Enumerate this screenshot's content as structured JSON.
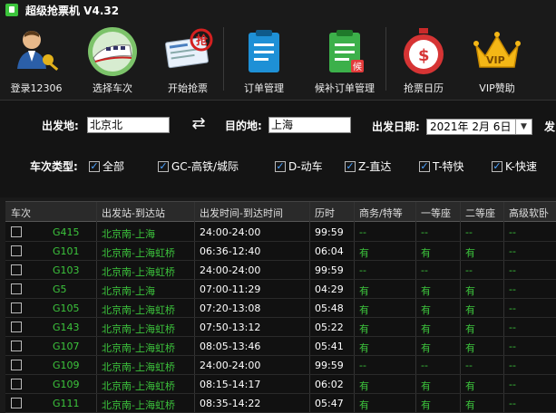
{
  "window": {
    "title": "超级抢票机 V4.32"
  },
  "toolbar": [
    {
      "label": "登录12306",
      "icon": "user-key-icon"
    },
    {
      "label": "选择车次",
      "icon": "train-icon"
    },
    {
      "label": "开始抢票",
      "icon": "ticket-grab-icon"
    },
    {
      "label": "订单管理",
      "icon": "order-icon"
    },
    {
      "label": "候补订单管理",
      "icon": "waitlist-order-icon"
    },
    {
      "label": "抢票日历",
      "icon": "stopwatch-icon"
    },
    {
      "label": "VIP赞助",
      "icon": "vip-crown-icon"
    }
  ],
  "filters": {
    "from_label": "出发地:",
    "from_value": "北京北",
    "to_label": "目的地:",
    "to_value": "上海",
    "date_label": "出发日期:",
    "date_value": "2021年  2月  6日",
    "extra_label": "发",
    "type_label": "车次类型:",
    "types": [
      "全部",
      "GC-高铁/城际",
      "D-动车",
      "Z-直达",
      "T-特快",
      "K-快速"
    ]
  },
  "table": {
    "headers": [
      "车次",
      "出发站-到达站",
      "出发时间-到达时间",
      "历时",
      "商务/特等",
      "一等座",
      "二等座",
      "高级软卧"
    ],
    "rows": [
      [
        "G415",
        "北京南-上海",
        "24:00-24:00",
        "99:59",
        "--",
        "--",
        "--",
        "--"
      ],
      [
        "G101",
        "北京南-上海虹桥",
        "06:36-12:40",
        "06:04",
        "有",
        "有",
        "有",
        "--"
      ],
      [
        "G103",
        "北京南-上海虹桥",
        "24:00-24:00",
        "99:59",
        "--",
        "--",
        "--",
        "--"
      ],
      [
        "G5",
        "北京南-上海",
        "07:00-11:29",
        "04:29",
        "有",
        "有",
        "有",
        "--"
      ],
      [
        "G105",
        "北京南-上海虹桥",
        "07:20-13:08",
        "05:48",
        "有",
        "有",
        "有",
        "--"
      ],
      [
        "G143",
        "北京南-上海虹桥",
        "07:50-13:12",
        "05:22",
        "有",
        "有",
        "有",
        "--"
      ],
      [
        "G107",
        "北京南-上海虹桥",
        "08:05-13:46",
        "05:41",
        "有",
        "有",
        "有",
        "--"
      ],
      [
        "G109",
        "北京南-上海虹桥",
        "24:00-24:00",
        "99:59",
        "--",
        "--",
        "--",
        "--"
      ],
      [
        "G109",
        "北京南-上海虹桥",
        "08:15-14:17",
        "06:02",
        "有",
        "有",
        "有",
        "--"
      ],
      [
        "G111",
        "北京南-上海虹桥",
        "08:35-14:22",
        "05:47",
        "有",
        "有",
        "有",
        "--"
      ]
    ]
  }
}
